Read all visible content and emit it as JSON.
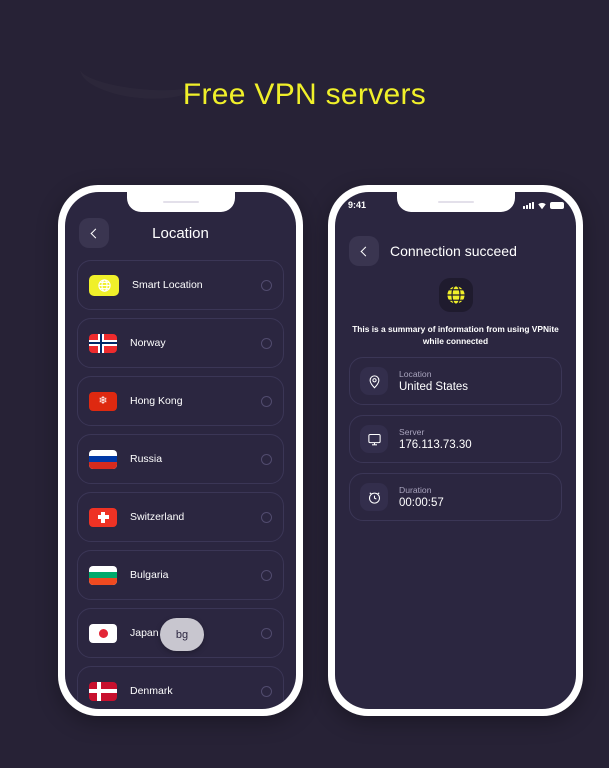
{
  "page": {
    "title": "Free VPN servers",
    "background_color": "#272236",
    "accent_color": "#f0f02a"
  },
  "phone_left": {
    "header": {
      "back_icon": "chevron-left-icon",
      "title": "Location"
    },
    "smart_location": {
      "icon": "globe-icon",
      "label": "Smart Location"
    },
    "locations": [
      {
        "label": "Norway",
        "flag": "no"
      },
      {
        "label": "Hong Kong",
        "flag": "hk"
      },
      {
        "label": "Russia",
        "flag": "ru"
      },
      {
        "label": "Switzerland",
        "flag": "ch"
      },
      {
        "label": "Bulgaria",
        "flag": "bg"
      },
      {
        "label": "Japan",
        "flag": "jp"
      },
      {
        "label": "Denmark",
        "flag": "dk"
      }
    ],
    "overlay_badge": "bg"
  },
  "phone_right": {
    "statusbar": {
      "time": "9:41",
      "signal_icon": "signal-bars-icon",
      "wifi_icon": "wifi-icon",
      "battery_icon": "battery-icon"
    },
    "header": {
      "back_icon": "chevron-left-icon",
      "title": "Connection succeed"
    },
    "hero_icon": "globe-icon",
    "summary": "This is a summary of information from using VPNite while connected",
    "cards": [
      {
        "icon": "map-pin-icon",
        "label": "Location",
        "value": "United States"
      },
      {
        "icon": "monitor-icon",
        "label": "Server",
        "value": "176.113.73.30"
      },
      {
        "icon": "alarm-clock-icon",
        "label": "Duration",
        "value": "00:00:57"
      }
    ]
  }
}
